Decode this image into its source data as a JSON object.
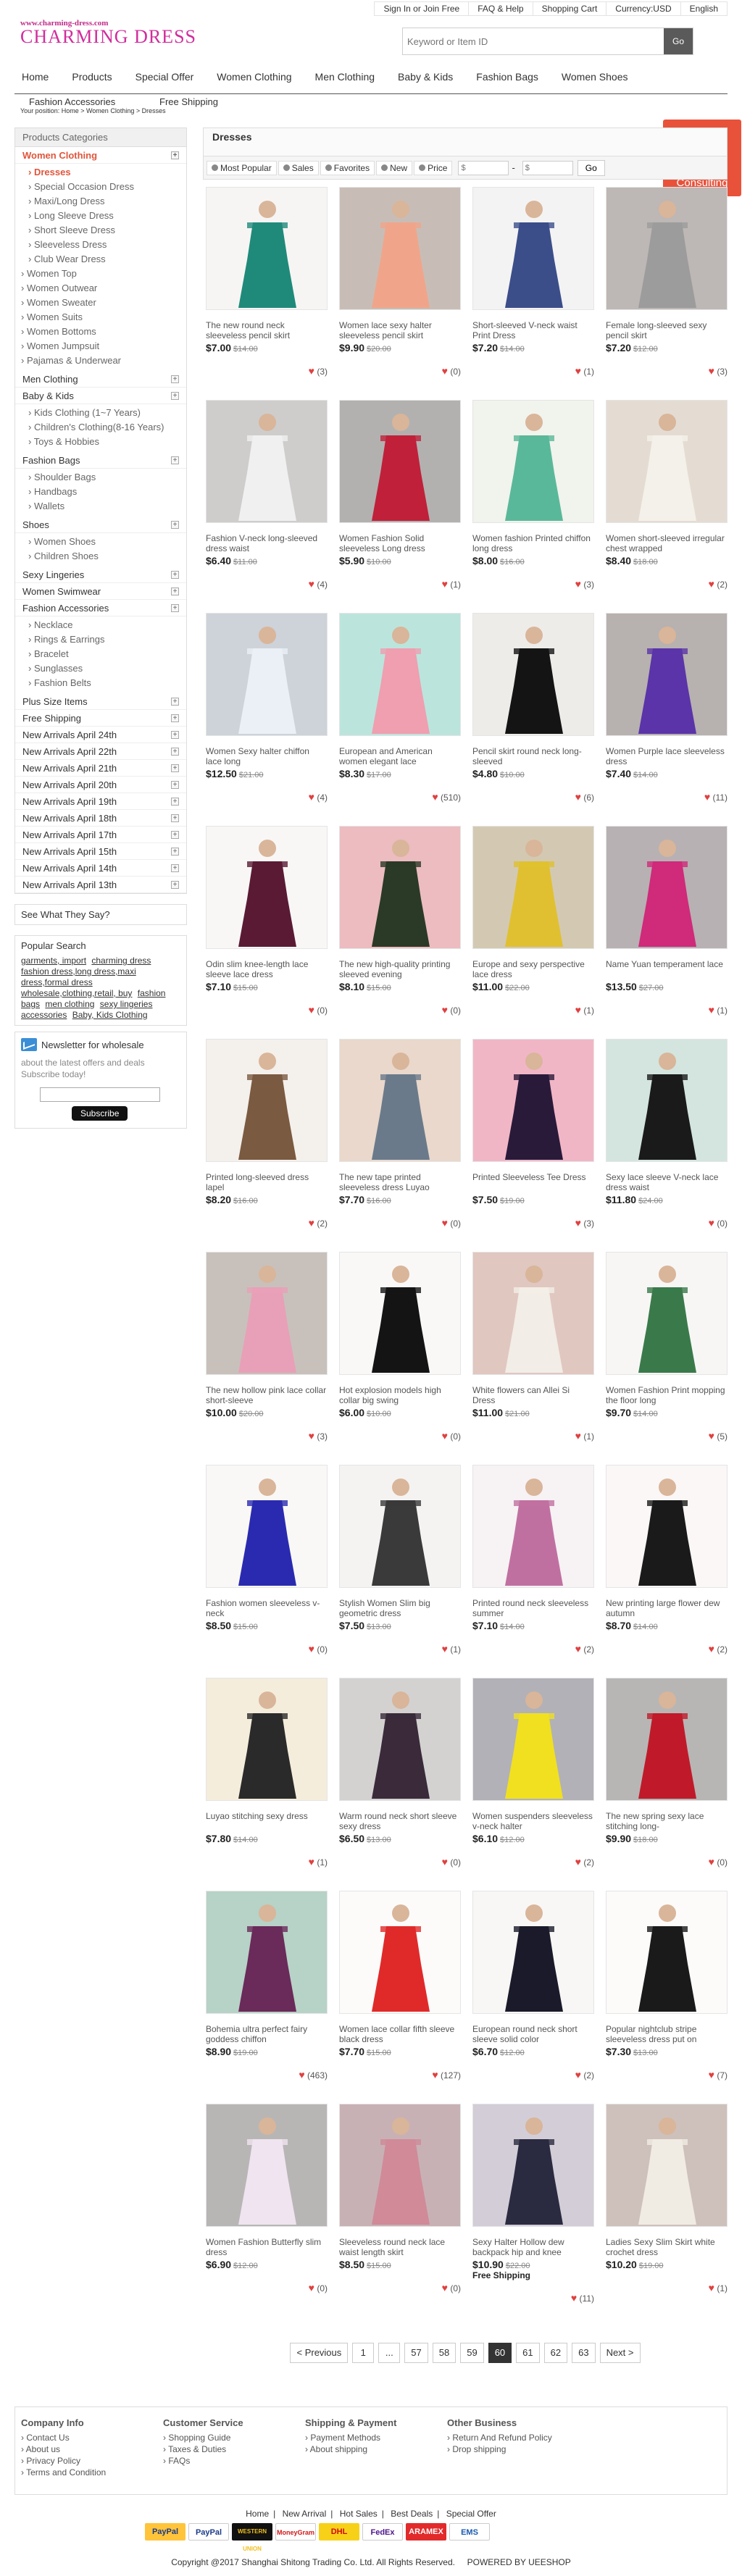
{
  "topnav": [
    "Sign In or Join Free",
    "FAQ & Help",
    "Shopping Cart",
    "Currency:USD",
    "English"
  ],
  "logo": {
    "url": "www.charming-dress.com",
    "name": "CHARMING DRESS"
  },
  "search": {
    "placeholder": "Keyword or Item ID",
    "button": "Go"
  },
  "mainnav": [
    "Home",
    "Products",
    "Special Offer",
    "Women Clothing",
    "Men Clothing",
    "Baby & Kids",
    "Fashion Bags",
    "Women Shoes"
  ],
  "mainnav2": [
    "Fashion Accessories",
    "Free Shipping"
  ],
  "breadcrumb": "Your position: Home > Women Clothing > Dresses",
  "consult": "Consulting",
  "sidebar": {
    "header": "Products Categories",
    "women": {
      "label": "Women Clothing",
      "items": [
        "Dresses",
        "Special Occasion Dress",
        "Maxi/Long Dress",
        "Long Sleeve Dress",
        "Short Sleeve Dress",
        "Sleeveless Dress",
        "Club Wear Dress"
      ],
      "items2": [
        "Women Top",
        "Women Outwear",
        "Women Sweater",
        "Women Suits",
        "Women Bottoms",
        "Women Jumpsuit",
        "Pajamas & Underwear"
      ]
    },
    "men": "Men Clothing",
    "kids": {
      "label": "Baby & Kids",
      "items": [
        "Kids Clothing (1~7 Years)",
        "Children's Clothing(8-16 Years)",
        "Toys & Hobbies"
      ]
    },
    "bags": {
      "label": "Fashion Bags",
      "items": [
        "Shoulder Bags",
        "Handbags",
        "Wallets"
      ]
    },
    "shoes": {
      "label": "Shoes",
      "items": [
        "Women Shoes",
        "Children Shoes"
      ]
    },
    "lingeries": "Sexy Lingeries",
    "swimwear": "Women Swimwear",
    "accessories": {
      "label": "Fashion Accessories",
      "items": [
        "Necklace",
        "Rings & Earrings",
        "Bracelet",
        "Sunglasses",
        "Fashion Belts"
      ]
    },
    "others": [
      "Plus Size Items",
      "Free Shipping",
      "New Arrivals April 24th",
      "New Arrivals April 22th",
      "New Arrivals April 21th",
      "New Arrivals April 20th",
      "New Arrivals April 19th",
      "New Arrivals April 18th",
      "New Arrivals April 17th",
      "New Arrivals April 15th",
      "New Arrivals April 14th",
      "New Arrivals April 13th"
    ],
    "see": "See What They Say?",
    "popular": {
      "title": "Popular Search",
      "tags": [
        "garments, import",
        "charming dress",
        "fashion dress,long dress,maxi dress,formal dress",
        "wholesale,clothing,retail, buy",
        "fashion bags",
        "men clothing",
        "sexy lingeries",
        "accessories",
        "Baby, Kids Clothing"
      ]
    },
    "newsletter": {
      "title": "Newsletter for wholesale",
      "desc": "about the latest offers and deals Subscribe today!",
      "button": "Subscribe"
    }
  },
  "content": {
    "title": "Dresses",
    "filters": [
      "Most Popular",
      "Sales",
      "Favorites",
      "New",
      "Price"
    ],
    "price_from": "$",
    "price_to": "$",
    "go": "Go"
  },
  "colors": {
    "accent": "#e8523b",
    "brand": "#d12d9c"
  },
  "products": [
    {
      "name": "The new round neck sleeveless pencil skirt",
      "price": "$7.00",
      "old": "$14.00",
      "likes": "(3)",
      "c1": "#1f8a7a",
      "c2": "#eee"
    },
    {
      "name": "Women lace sexy halter sleeveless pencil skirt",
      "price": "$9.90",
      "old": "$20.00",
      "likes": "(0)",
      "c1": "#f0a58a",
      "c2": "#6b4c3b"
    },
    {
      "name": "Short-sleeved V-neck waist Print Dress",
      "price": "$7.20",
      "old": "$14.00",
      "likes": "(1)",
      "c1": "#3b4e8a",
      "c2": "#e9e7ea"
    },
    {
      "name": "Female long-sleeved sexy pencil skirt",
      "price": "$7.20",
      "old": "$12.00",
      "likes": "(3)",
      "c1": "#9c9c9c",
      "c2": "#4a3b3a"
    },
    {
      "name": "Fashion V-neck long-sleeved dress waist",
      "price": "$6.40",
      "old": "$11.00",
      "likes": "(4)",
      "c1": "#f0f0f0",
      "c2": "#7a7a7a"
    },
    {
      "name": "Women Fashion Solid sleeveless Long dress",
      "price": "$5.90",
      "old": "$10.00",
      "likes": "(1)",
      "c1": "#c0203a",
      "c2": "#2a2a2a"
    },
    {
      "name": "Women fashion Printed chiffon long dress",
      "price": "$8.00",
      "old": "$16.00",
      "likes": "(3)",
      "c1": "#5ab89a",
      "c2": "#dfe9d9"
    },
    {
      "name": "Women short-sleeved irregular chest wrapped",
      "price": "$8.40",
      "old": "$18.00",
      "likes": "(2)",
      "c1": "#f4f1ea",
      "c2": "#b9a68f"
    },
    {
      "name": "Women Sexy halter chiffon lace long",
      "price": "$12.50",
      "old": "$21.00",
      "likes": "(4)",
      "c1": "#eaf0f6",
      "c2": "#7a8aa0"
    },
    {
      "name": "European and American women elegant lace",
      "price": "$8.30",
      "old": "$17.00",
      "likes": "(510)",
      "c1": "#ef9fb0",
      "c2": "#46c1a8"
    },
    {
      "name": "Pencil skirt round neck long-sleeved",
      "price": "$4.80",
      "old": "$10.00",
      "likes": "(6)",
      "c1": "#141414",
      "c2": "#d8d4cf"
    },
    {
      "name": "Women Purple lace sleeveless dress",
      "price": "$7.40",
      "old": "$14.00",
      "likes": "(11)",
      "c1": "#5a34a8",
      "c2": "#3a2a2a"
    },
    {
      "name": "Odin slim knee-length lace sleeve lace dress",
      "price": "$7.10",
      "old": "$15.00",
      "likes": "(0)",
      "c1": "#5a1a34",
      "c2": "#f3f3f3"
    },
    {
      "name": "The new high-quality printing sleeved evening",
      "price": "$8.10",
      "old": "$15.00",
      "likes": "(0)",
      "c1": "#2a3a26",
      "c2": "#d04a5a"
    },
    {
      "name": "Europe and sexy perspective lace dress",
      "price": "$11.00",
      "old": "$22.00",
      "likes": "(1)",
      "c1": "#e0c030",
      "c2": "#8a7030"
    },
    {
      "name": "Name Yuan temperament lace",
      "price": "$13.50",
      "old": "$27.00",
      "likes": "(1)",
      "c1": "#d02a7a",
      "c2": "#3a2a34"
    },
    {
      "name": "Printed long-sleeved dress lapel",
      "price": "$8.20",
      "old": "$16.00",
      "likes": "(2)",
      "c1": "#7a5a40",
      "c2": "#e8e0d8"
    },
    {
      "name": "The new tape printed sleeveless dress Luyao",
      "price": "$7.70",
      "old": "$16.00",
      "likes": "(0)",
      "c1": "#6a7a8a",
      "c2": "#c89a78"
    },
    {
      "name": "Printed Sleeveless Tee Dress",
      "price": "$7.50",
      "old": "$19.00",
      "likes": "(3)",
      "c1": "#2a1a3a",
      "c2": "#e03a6a"
    },
    {
      "name": "Sexy lace sleeve V-neck lace dress waist",
      "price": "$11.80",
      "old": "$24.00",
      "likes": "(0)",
      "c1": "#1a1a1a",
      "c2": "#8ac0b0"
    },
    {
      "name": "The new hollow pink lace collar short-sleeve",
      "price": "$10.00",
      "old": "$20.00",
      "likes": "(3)",
      "c1": "#e8a0b8",
      "c2": "#6a5a4a"
    },
    {
      "name": "Hot explosion models high collar big swing",
      "price": "$6.00",
      "old": "$10.00",
      "likes": "(0)",
      "c1": "#141414",
      "c2": "#f6f6f6"
    },
    {
      "name": "White flowers can Allei Si Dress",
      "price": "$11.00",
      "old": "$21.00",
      "likes": "(1)",
      "c1": "#f2ede6",
      "c2": "#b06a5a"
    },
    {
      "name": "Women Fashion Print mopping the floor long",
      "price": "$9.70",
      "old": "$14.00",
      "likes": "(5)",
      "c1": "#3a7a4a",
      "c2": "#f0f0f0"
    },
    {
      "name": "Fashion women sleeveless v-neck",
      "price": "$8.50",
      "old": "$15.00",
      "likes": "(0)",
      "c1": "#2a2ab0",
      "c2": "#f7f7f7"
    },
    {
      "name": "Stylish Women Slim big geometric dress",
      "price": "$7.50",
      "old": "$13.00",
      "likes": "(1)",
      "c1": "#3a3a3a",
      "c2": "#e8e8e8"
    },
    {
      "name": "Printed round neck sleeveless summer",
      "price": "$7.10",
      "old": "$14.00",
      "likes": "(2)",
      "c1": "#c070a0",
      "c2": "#f0e6ee"
    },
    {
      "name": "New printing large flower dew autumn",
      "price": "$8.70",
      "old": "$14.00",
      "likes": "(2)",
      "c1": "#1a1a1a",
      "c2": "#f8f4f4"
    },
    {
      "name": "Luyao stitching sexy dress",
      "price": "$7.80",
      "old": "$14.00",
      "likes": "(1)",
      "c1": "#2a2a2a",
      "c2": "#e8d8a8"
    },
    {
      "name": "Warm round neck short sleeve sexy dress",
      "price": "$6.50",
      "old": "$13.00",
      "likes": "(0)",
      "c1": "#3a2a3a",
      "c2": "#8a8a8a"
    },
    {
      "name": "Women suspenders sleeveless v-neck halter",
      "price": "$6.10",
      "old": "$12.00",
      "likes": "(2)",
      "c1": "#f0e020",
      "c2": "#2a2a40"
    },
    {
      "name": "The new spring sexy lace stitching long-",
      "price": "$9.90",
      "old": "$18.00",
      "likes": "(0)",
      "c1": "#c01a2a",
      "c2": "#3a3a3a"
    },
    {
      "name": "Bohemia ultra perfect fairy goddess chiffon",
      "price": "$8.90",
      "old": "$19.00",
      "likes": "(463)",
      "c1": "#6a2a5a",
      "c2": "#3a8a6a"
    },
    {
      "name": "Women lace collar fifth sleeve black dress",
      "price": "$7.70",
      "old": "$15.00",
      "likes": "(127)",
      "c1": "#e02a2a",
      "c2": "#ffffff"
    },
    {
      "name": "European round neck short sleeve solid color",
      "price": "$6.70",
      "old": "$12.00",
      "likes": "(2)",
      "c1": "#1a1a2a",
      "c2": "#f4f4f4"
    },
    {
      "name": "Popular nightclub stripe sleeveless dress put on",
      "price": "$7.30",
      "old": "$13.00",
      "likes": "(7)",
      "c1": "#1a1a1a",
      "c2": "#ffffff"
    },
    {
      "name": "Women Fashion Butterfly slim dress",
      "price": "$6.90",
      "old": "$12.00",
      "likes": "(0)",
      "c1": "#f0e4f0",
      "c2": "#3a3a3a"
    },
    {
      "name": "Sleeveless round neck lace waist length skirt",
      "price": "$8.50",
      "old": "$15.00",
      "likes": "(0)",
      "c1": "#d08a98",
      "c2": "#6a2a3a"
    },
    {
      "name": "Sexy Halter Hollow dew backpack hip and knee",
      "price": "$10.90",
      "old": "$22.00",
      "likes": "(11)",
      "ship": "Free Shipping",
      "c1": "#2a2a40",
      "c2": "#8a7a9a"
    },
    {
      "name": "Ladies Sexy Slim Skirt white crochet dress",
      "price": "$10.20",
      "old": "$19.00",
      "likes": "(1)",
      "c1": "#f0ece4",
      "c2": "#7a5a4a"
    }
  ],
  "pager": [
    "< Previous",
    "1",
    "...",
    "57",
    "58",
    "59",
    "60",
    "61",
    "62",
    "63",
    "Next >"
  ],
  "pager_current": "60",
  "footer": [
    {
      "title": "Company Info",
      "items": [
        "Contact Us",
        "About us",
        "Privacy Policy",
        "Terms and Condition"
      ]
    },
    {
      "title": "Customer Service",
      "items": [
        "Shopping Guide",
        "Taxes & Duties",
        "FAQs"
      ]
    },
    {
      "title": "Shipping & Payment",
      "items": [
        "Payment Methods",
        "About shipping"
      ]
    },
    {
      "title": "Other Business",
      "items": [
        "Return And Refund Policy",
        "Drop shipping"
      ]
    }
  ],
  "bottomlinks": [
    "Home",
    "New Arrival",
    "Hot Sales",
    "Best Deals",
    "Special Offer"
  ],
  "payments": [
    "PayPal",
    "PayPal",
    "WESTERN UNION",
    "MoneyGram",
    "DHL",
    "FedEx",
    "ARAMEX",
    "EMS"
  ],
  "copyright": "Copyright @2017 Shanghai Shitong Trading Co. Ltd. All Rights Reserved.",
  "powered": "POWERED BY UEESHOP"
}
